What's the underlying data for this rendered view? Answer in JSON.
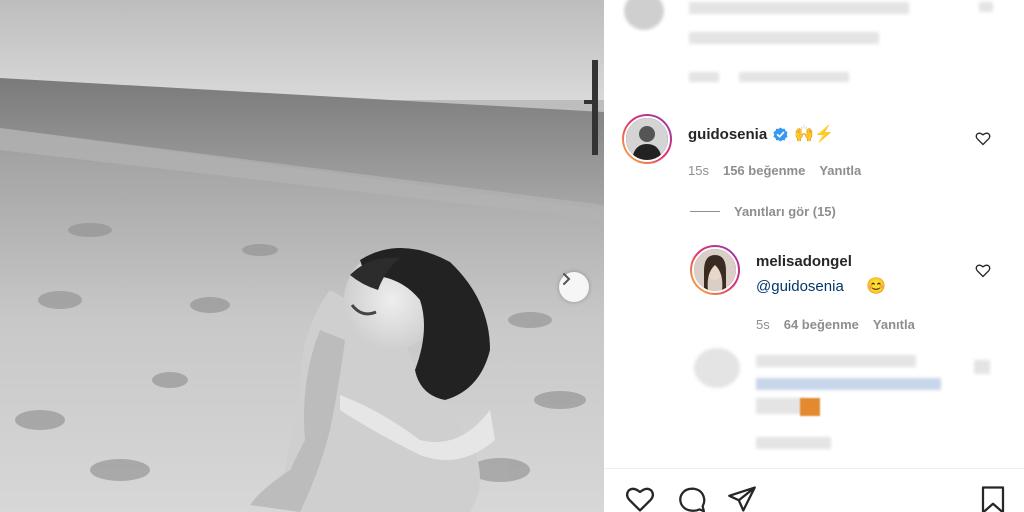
{
  "comments": [
    {
      "username": "guidosenia",
      "verified": true,
      "emojis": "🙌⚡",
      "time": "15s",
      "likes": "156 beğenme",
      "reply": "Yanıtla"
    }
  ],
  "view_replies": "Yanıtları gör (15)",
  "reply_comment": {
    "username": "melisadongel",
    "mention": "@guidosenia",
    "emoji": "😊",
    "time": "5s",
    "likes": "64 beğenme",
    "reply": "Yanıtla"
  },
  "colors": {
    "verified_badge": "#3897f0",
    "mention_link": "#00376b",
    "meta_gray": "#8e8e8e"
  },
  "icons": {
    "like": "heart-icon",
    "comment": "comment-icon",
    "share": "paper-plane-icon",
    "save": "bookmark-icon",
    "carousel": "chevron-right-icon"
  }
}
